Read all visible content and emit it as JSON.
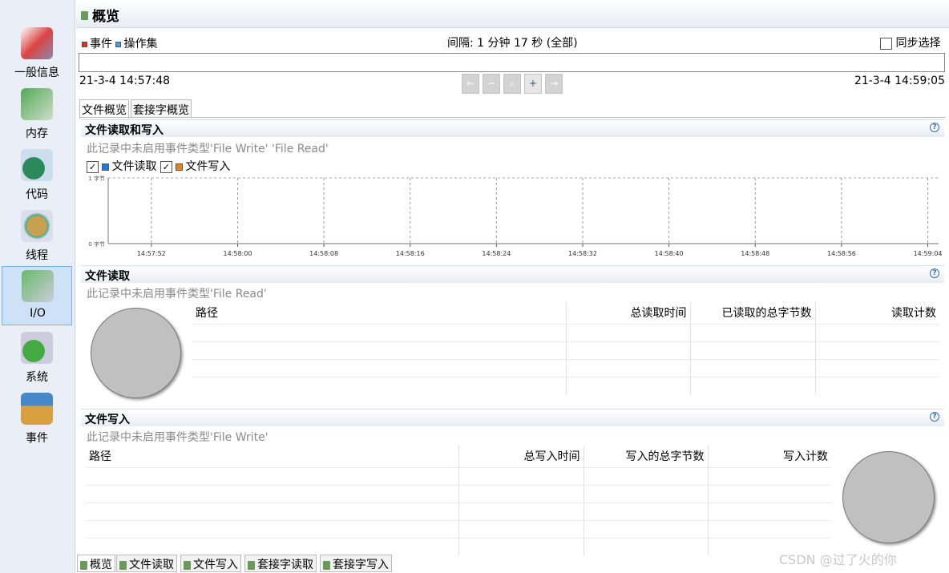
{
  "sidebar": {
    "items": [
      {
        "label": "一般信息",
        "icon": "general-info-icon"
      },
      {
        "label": "内存",
        "icon": "memory-icon"
      },
      {
        "label": "代码",
        "icon": "code-icon"
      },
      {
        "label": "线程",
        "icon": "threads-icon"
      },
      {
        "label": "I/O",
        "icon": "io-icon",
        "selected": true
      },
      {
        "label": "系统",
        "icon": "system-icon"
      },
      {
        "label": "事件",
        "icon": "events-icon"
      }
    ]
  },
  "header": {
    "title": "概览"
  },
  "timeline": {
    "legend_events": "事件",
    "legend_opsets": "操作集",
    "interval": "间隔: 1 分钟 17 秒 (全部)",
    "sync_label": "同步选择",
    "start": "21-3-4 14:57:48",
    "end": "21-3-4 14:59:05",
    "colors": {
      "events": "#e03010",
      "opsets": "#40a0e0"
    }
  },
  "tabs": [
    "文件概览",
    "套接字概览"
  ],
  "sec1": {
    "title": "文件读取和写入",
    "note": "此记录中未启用事件类型'File Write' 'File Read'",
    "read_label": "文件读取",
    "write_label": "文件写入",
    "read_color": "#1a7ae0",
    "write_color": "#f08010"
  },
  "chart_data": {
    "type": "line",
    "series": [
      {
        "name": "文件读取",
        "values": []
      },
      {
        "name": "文件写入",
        "values": []
      }
    ],
    "ytick_labels": [
      "0 字节",
      "1 字节"
    ],
    "ylim": [
      0,
      1
    ],
    "xlim": [
      "14:57:48",
      "14:59:05"
    ],
    "xtick_labels": [
      "14:57:52",
      "14:58:00",
      "14:58:08",
      "14:58:16",
      "14:58:24",
      "14:58:32",
      "14:58:40",
      "14:58:48",
      "14:58:56",
      "14:59:04"
    ],
    "grid": true
  },
  "sec2": {
    "title": "文件读取",
    "note": "此记录中未启用事件类型'File Read'",
    "columns": [
      "路径",
      "总读取时间",
      "已读取的总字节数",
      "读取计数"
    ]
  },
  "sec3": {
    "title": "文件写入",
    "note": "此记录中未启用事件类型'File Write'",
    "columns": [
      "路径",
      "总写入时间",
      "写入的总字节数",
      "写入计数"
    ]
  },
  "bottom_tabs": [
    "概览",
    "文件读取",
    "文件写入",
    "套接字读取",
    "套接字写入"
  ],
  "watermark": "CSDN @过了火的你"
}
